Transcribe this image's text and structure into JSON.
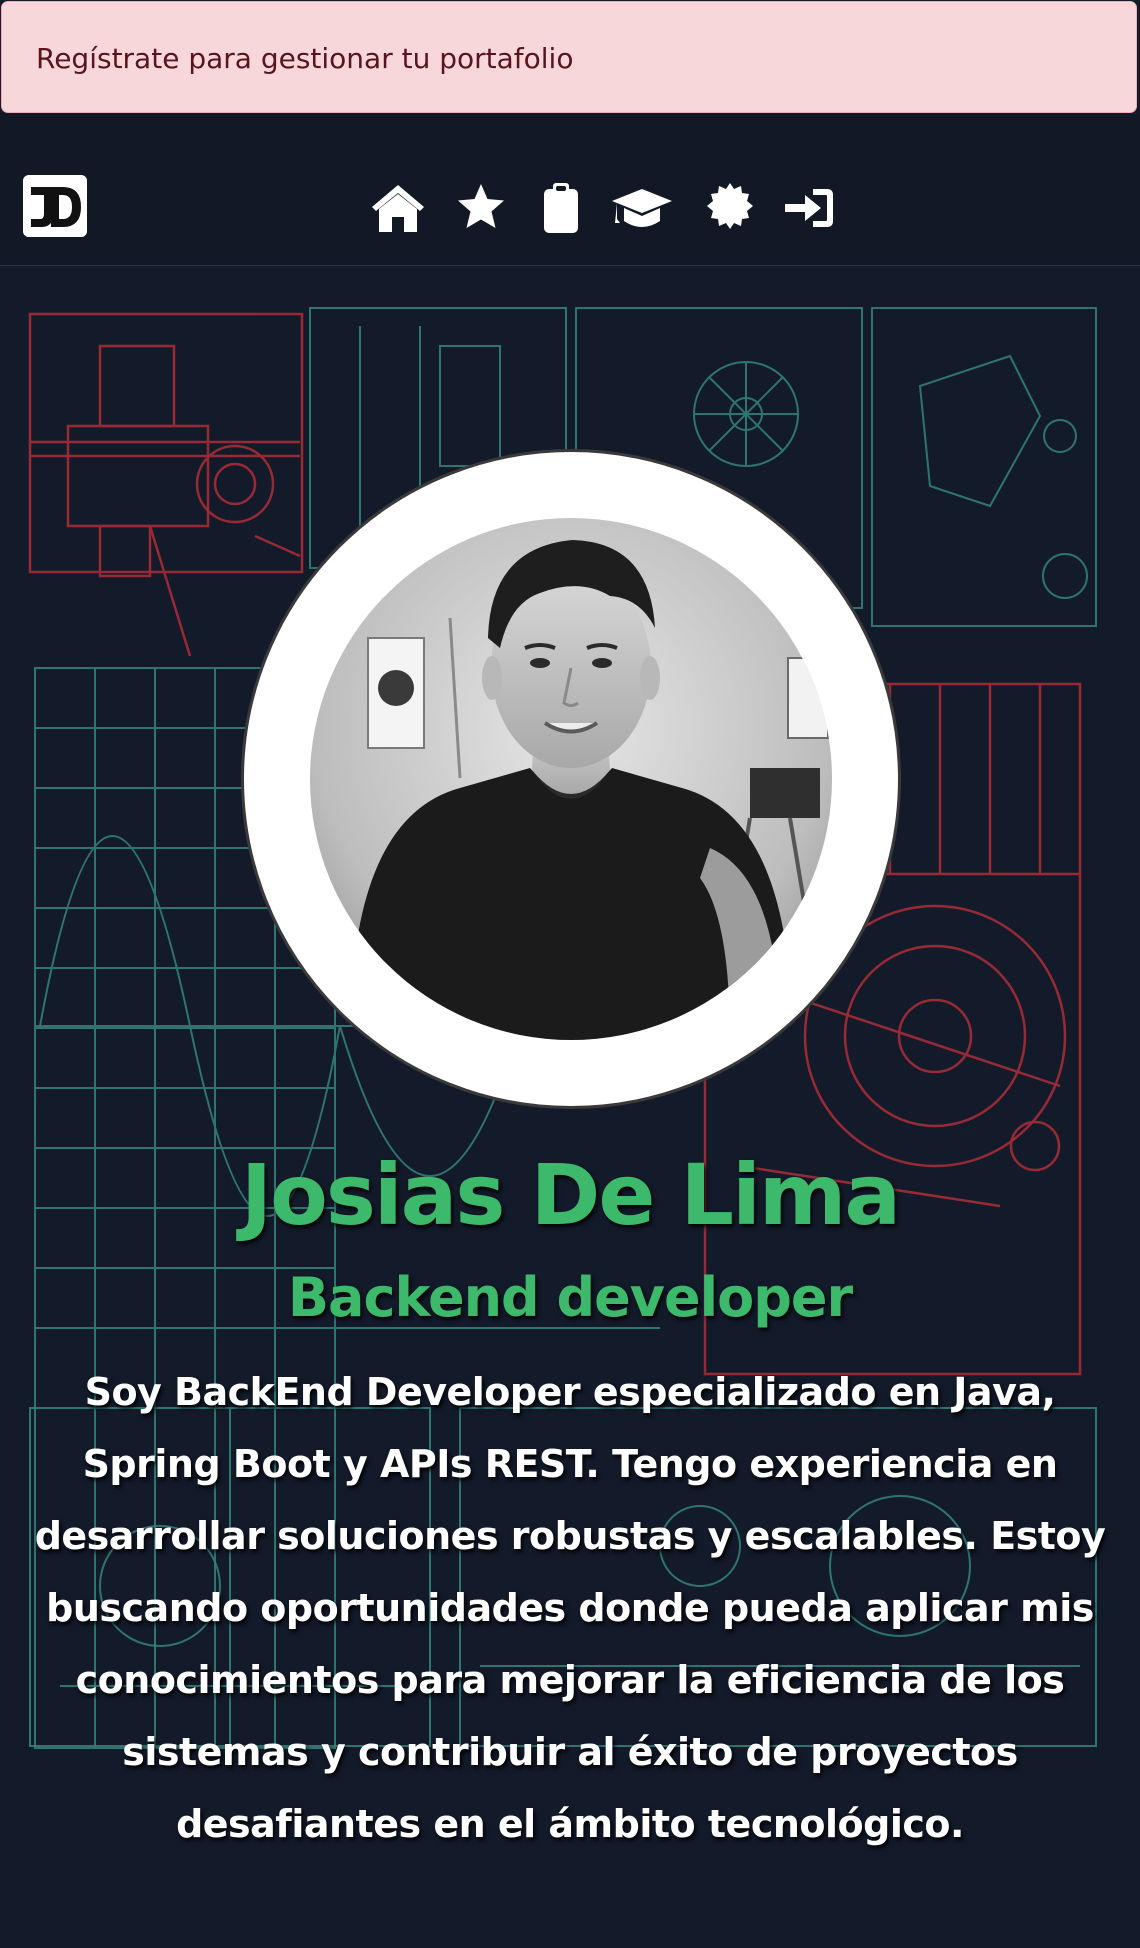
{
  "alert": {
    "text": "Regístrate para gestionar tu portafolio"
  },
  "navbar": {
    "logo": {
      "name": "jd-logo",
      "text": "JD"
    },
    "icons": [
      "home-icon",
      "star-icon",
      "clipboard-icon",
      "graduation-cap-icon",
      "certificate-icon",
      "login-icon"
    ]
  },
  "hero": {
    "name": "Josias De Lima",
    "role": "Backend developer",
    "bio": "Soy BackEnd Developer especializado en Java, Spring Boot y APIs REST. Tengo experiencia en desarrollar soluciones robustas y escalables. Estoy buscando oportunidades donde pueda aplicar mis conocimientos para mejorar la eficiencia de los sistemas y contribuir al éxito de proyectos desafiantes en el ámbito tecnológico."
  },
  "colors": {
    "alert_bg": "#f8d7da",
    "alert_text": "#58151c",
    "navbar_bg": "#121826",
    "page_bg": "#141a2a",
    "accent_green": "#3cb96a",
    "blueprint_red": "#c0303a",
    "blueprint_teal": "#3a9a8a"
  }
}
